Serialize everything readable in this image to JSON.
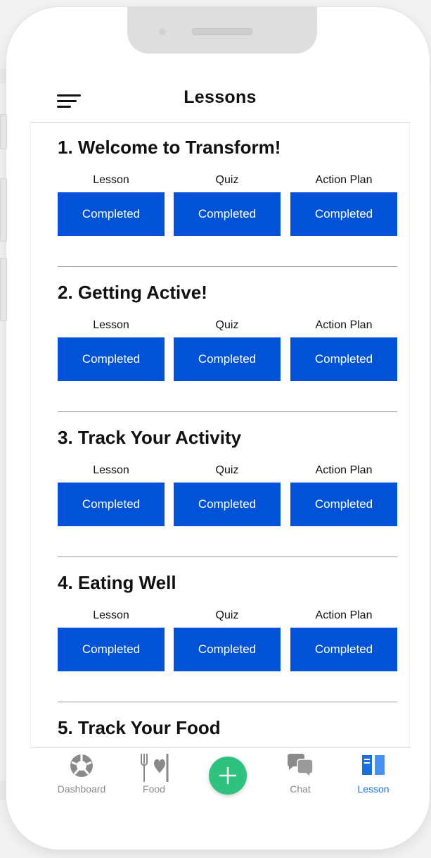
{
  "header": {
    "title": "Lessons",
    "menu_icon": "hamburger-menu-icon"
  },
  "column_labels": [
    "Lesson",
    "Quiz",
    "Action Plan"
  ],
  "lessons": [
    {
      "title": "1. Welcome to Transform!",
      "lesson": "Completed",
      "quiz": "Completed",
      "action_plan": "Completed"
    },
    {
      "title": "2. Getting Active!",
      "lesson": "Completed",
      "quiz": "Completed",
      "action_plan": "Completed"
    },
    {
      "title": "3. Track Your Activity",
      "lesson": "Completed",
      "quiz": "Completed",
      "action_plan": "Completed"
    },
    {
      "title": "4. Eating Well",
      "lesson": "Completed",
      "quiz": "Completed",
      "action_plan": "Completed"
    },
    {
      "title": "5. Track Your Food"
    }
  ],
  "tabbar": {
    "dashboard": {
      "label": "Dashboard",
      "icon": "dashboard-icon"
    },
    "food": {
      "label": "Food",
      "icon": "food-icon"
    },
    "add": {
      "icon": "plus-icon"
    },
    "chat": {
      "label": "Chat",
      "icon": "chat-icon"
    },
    "lesson": {
      "label": "Lesson",
      "icon": "lesson-book-icon",
      "active": true
    }
  },
  "colors": {
    "button": "#0152d6",
    "accent": "#1a6fe0",
    "add_button": "#2ec27e"
  }
}
